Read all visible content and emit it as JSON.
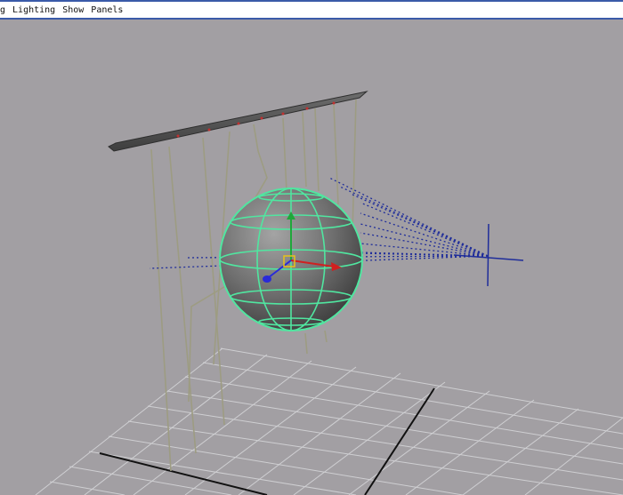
{
  "menubar": {
    "items": [
      {
        "label": "g"
      },
      {
        "label": "Lighting"
      },
      {
        "label": "Show"
      },
      {
        "label": "Panels"
      }
    ]
  },
  "viewport": {
    "background": "#a29fa3",
    "grid_color": "#cfcfd2",
    "axis_color": "#111111",
    "wireframe_color": "#50e6a0",
    "light_rays_color": "#1f2d9a",
    "manipulator": {
      "x_axis_color": "#d02020",
      "y_axis_color": "#1fa83a",
      "z_axis_color": "#2a2ad8",
      "center_color": "#e6c21a"
    }
  }
}
